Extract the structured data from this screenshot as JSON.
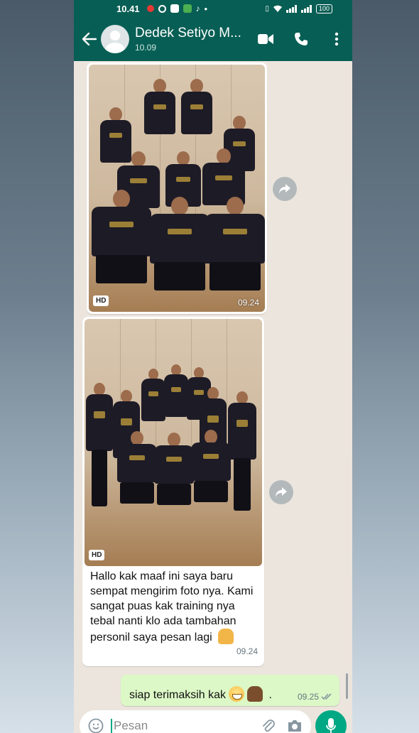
{
  "status": {
    "time": "10.41",
    "battery": "100"
  },
  "header": {
    "contact_name": "Dedek Setiyo M...",
    "subtitle": "10.09"
  },
  "messages": [
    {
      "type": "image",
      "badge": "HD",
      "time": "09.24"
    },
    {
      "type": "image",
      "badge": "HD",
      "caption": "Hallo kak maaf ini saya baru sempat mengirim foto nya. Kami sangat puas kak training nya tebal nanti klo ada tambahan personil saya pesan lagi",
      "time": "09.24"
    },
    {
      "type": "text_out",
      "text": "siap terimaksih kak",
      "trail": ".",
      "time": "09.25"
    }
  ],
  "composer": {
    "placeholder": "Pesan"
  },
  "colors": {
    "header": "#075e54",
    "chat_bg": "#ece5dd",
    "outgoing": "#dcf8c6",
    "accent": "#00a884"
  },
  "icons": [
    "back-arrow-icon",
    "video-call-icon",
    "phone-icon",
    "more-vert-icon",
    "forward-icon",
    "emoji-icon",
    "attach-icon",
    "camera-icon",
    "mic-icon",
    "double-check-icon"
  ]
}
